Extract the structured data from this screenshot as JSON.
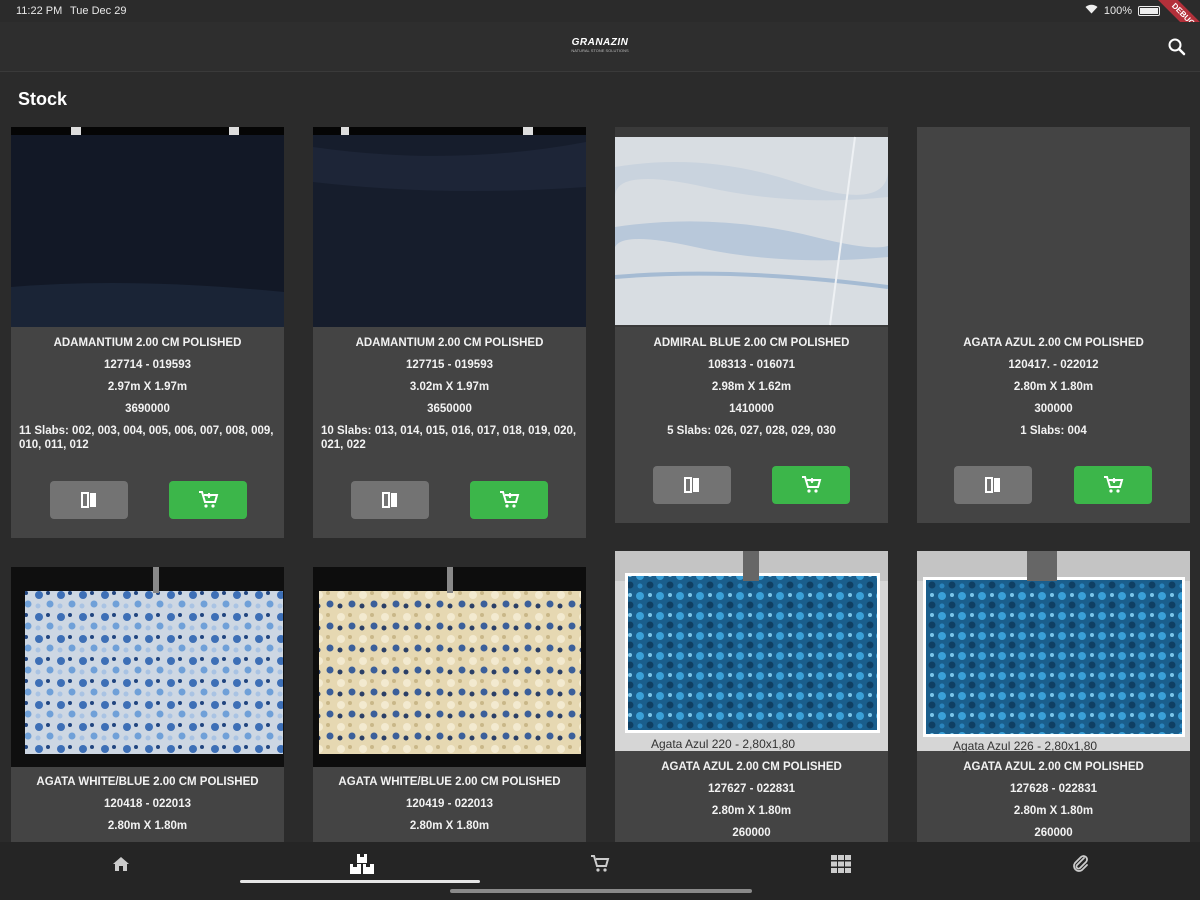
{
  "status": {
    "time": "11:22 PM",
    "date": "Tue Dec 29",
    "battery": "100%",
    "debug_label": "DEBUG"
  },
  "appbar": {
    "logo_main": "GRANAZIN",
    "logo_sub": "NATURAL STONE SOLUTIONS"
  },
  "page": {
    "title": "Stock"
  },
  "colors": {
    "background": "#2b2b2b",
    "card": "#444444",
    "accent_green": "#3cb64a",
    "button_grey": "#737373"
  },
  "products": [
    {
      "name": "ADAMANTIUM 2.00 CM POLISHED",
      "code": "127714 - 019593",
      "size": "2.97m X 1.97m",
      "price": "3690000",
      "slabs": "11 Slabs: 002, 003, 004, 005, 006, 007, 008, 009, 010, 011, 012"
    },
    {
      "name": "ADAMANTIUM 2.00 CM POLISHED",
      "code": "127715 - 019593",
      "size": "3.02m X 1.97m",
      "price": "3650000",
      "slabs": "10 Slabs: 013, 014, 015, 016, 017, 018, 019, 020, 021, 022"
    },
    {
      "name": "ADMIRAL BLUE 2.00 CM POLISHED",
      "code": "108313 - 016071",
      "size": "2.98m X 1.62m",
      "price": "1410000",
      "slabs": "5 Slabs: 026, 027, 028, 029, 030"
    },
    {
      "name": "AGATA AZUL 2.00 CM POLISHED",
      "code": "120417. - 022012",
      "size": "2.80m X 1.80m",
      "price": "300000",
      "slabs": "1 Slabs: 004"
    },
    {
      "name": "AGATA WHITE/BLUE 2.00 CM POLISHED",
      "code": "120418 - 022013",
      "size": "2.80m X 1.80m"
    },
    {
      "name": "AGATA WHITE/BLUE 2.00 CM POLISHED",
      "code": "120419 - 022013",
      "size": "2.80m X 1.80m"
    },
    {
      "name": "AGATA AZUL 2.00 CM POLISHED",
      "code": "127627 - 022831",
      "size": "2.80m X 1.80m",
      "price": "260000",
      "photo_caption": "Agata Azul 220 - 2,80x1,80"
    },
    {
      "name": "AGATA AZUL 2.00 CM POLISHED",
      "code": "127628 - 022831",
      "size": "2.80m X 1.80m",
      "price": "260000",
      "photo_caption": "Agata Azul 226 - 2,80x1,80"
    }
  ],
  "bottom_nav": [
    {
      "icon": "home-icon"
    },
    {
      "icon": "stock-boxes-icon"
    },
    {
      "icon": "cart-icon"
    },
    {
      "icon": "grid-icon"
    },
    {
      "icon": "attachment-icon"
    }
  ]
}
